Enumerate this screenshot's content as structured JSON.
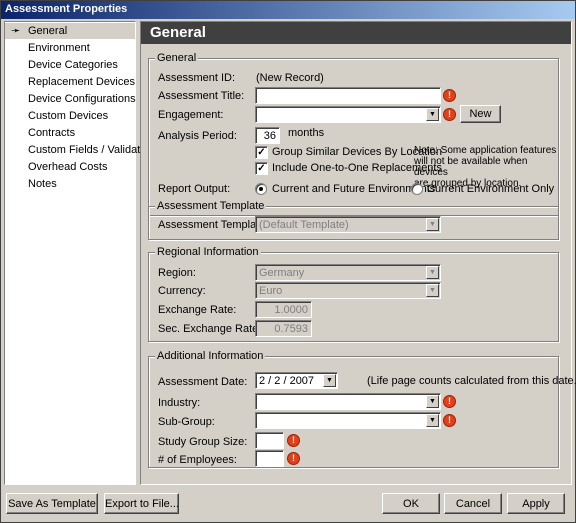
{
  "window": {
    "title": "Assessment Properties"
  },
  "sidebar": {
    "items": [
      {
        "label": "General"
      },
      {
        "label": "Environment"
      },
      {
        "label": "Device Categories"
      },
      {
        "label": "Replacement Devices"
      },
      {
        "label": "Device Configurations"
      },
      {
        "label": "Custom Devices"
      },
      {
        "label": "Contracts"
      },
      {
        "label": "Custom Fields / Validation"
      },
      {
        "label": "Overhead Costs"
      },
      {
        "label": "Notes"
      }
    ]
  },
  "header": {
    "title": "General"
  },
  "general": {
    "legend": "General",
    "assessment_id_label": "Assessment ID:",
    "assessment_id_value": "(New Record)",
    "title_label": "Assessment Title:",
    "title_value": "",
    "engagement_label": "Engagement:",
    "engagement_value": "",
    "new_button": "New",
    "analysis_period_label": "Analysis Period:",
    "analysis_period_value": "36",
    "analysis_period_unit": "months",
    "group_similar_label": "Group Similar Devices By Location",
    "group_similar_checked": true,
    "include_replacements_label": "Include One-to-One Replacements",
    "include_replacements_checked": true,
    "note_line1": "Note: Some application features",
    "note_line2": "will not be available when devices",
    "note_line3": "are grouped by location.",
    "report_output_label": "Report Output:",
    "radio_current_future": "Current and Future Environments",
    "radio_current_only": "Current Environment Only",
    "report_output_selected": "current_future"
  },
  "template": {
    "legend": "Assessment Template",
    "label": "Assessment Template:",
    "value": "(Default Template)"
  },
  "regional": {
    "legend": "Regional Information",
    "region_label": "Region:",
    "region_value": "Germany",
    "currency_label": "Currency:",
    "currency_value": "Euro",
    "exchange_rate_label": "Exchange  Rate:",
    "exchange_rate_value": "1.0000",
    "sec_exchange_rate_label": "Sec. Exchange  Rate:",
    "sec_exchange_rate_value": "0.7593"
  },
  "additional": {
    "legend": "Additional Information",
    "date_label": "Assessment Date:",
    "date_value": "2 /  2 / 2007",
    "date_note": "(Life page counts calculated from this date.)",
    "industry_label": "Industry:",
    "industry_value": "",
    "subgroup_label": "Sub-Group:",
    "subgroup_value": "",
    "study_group_label": "Study Group Size:",
    "study_group_value": "",
    "employees_label": "# of Employees:",
    "employees_value": ""
  },
  "footer": {
    "save_template": "Save As Template",
    "export": "Export to File...",
    "ok": "OK",
    "cancel": "Cancel",
    "apply": "Apply"
  },
  "icons": {
    "warning": "!",
    "dropdown": "▼",
    "check": "✓",
    "nav_arrow": "➛"
  },
  "colors": {
    "titlebar_start": "#0a246a",
    "header_bg": "#404040",
    "warning": "#e0401c"
  }
}
